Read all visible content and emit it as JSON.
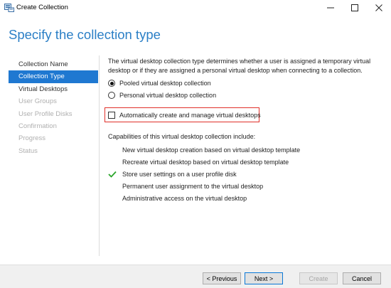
{
  "window": {
    "title": "Create Collection",
    "controls": {
      "minimize": "—",
      "maximize": "☐",
      "close": "✕"
    }
  },
  "page": {
    "heading": "Specify the collection type"
  },
  "nav": {
    "items": [
      {
        "label": "Collection Name",
        "state": "normal"
      },
      {
        "label": "Collection Type",
        "state": "active"
      },
      {
        "label": "Virtual Desktops",
        "state": "normal"
      },
      {
        "label": "User Groups",
        "state": "disabled"
      },
      {
        "label": "User Profile Disks",
        "state": "disabled"
      },
      {
        "label": "Confirmation",
        "state": "disabled"
      },
      {
        "label": "Progress",
        "state": "disabled"
      },
      {
        "label": "Status",
        "state": "disabled"
      }
    ]
  },
  "main": {
    "description": "The virtual desktop collection type determines whether a user is assigned a temporary virtual desktop or if they are assigned a personal virtual desktop when connecting to a collection.",
    "radios": [
      {
        "label": "Pooled virtual desktop collection",
        "selected": true
      },
      {
        "label": "Personal virtual desktop collection",
        "selected": false
      }
    ],
    "auto_checkbox": {
      "label": "Automatically create and manage virtual desktops",
      "checked": false
    },
    "capabilities_title": "Capabilities of this virtual desktop collection include:",
    "capabilities": [
      {
        "label": "New virtual desktop creation based on virtual desktop template",
        "checked": false
      },
      {
        "label": "Recreate virtual desktop based on virtual desktop template",
        "checked": false
      },
      {
        "label": "Store user settings on a user profile disk",
        "checked": true
      },
      {
        "label": "Permanent user assignment to the virtual desktop",
        "checked": false
      },
      {
        "label": "Administrative access on the virtual desktop",
        "checked": false
      }
    ]
  },
  "footer": {
    "previous": "< Previous",
    "next": "Next >",
    "create": "Create",
    "cancel": "Cancel"
  },
  "colors": {
    "accent": "#1f78d1",
    "heading": "#2b7fc6",
    "highlight_border": "#e0302a",
    "check_green": "#2aa52a"
  }
}
